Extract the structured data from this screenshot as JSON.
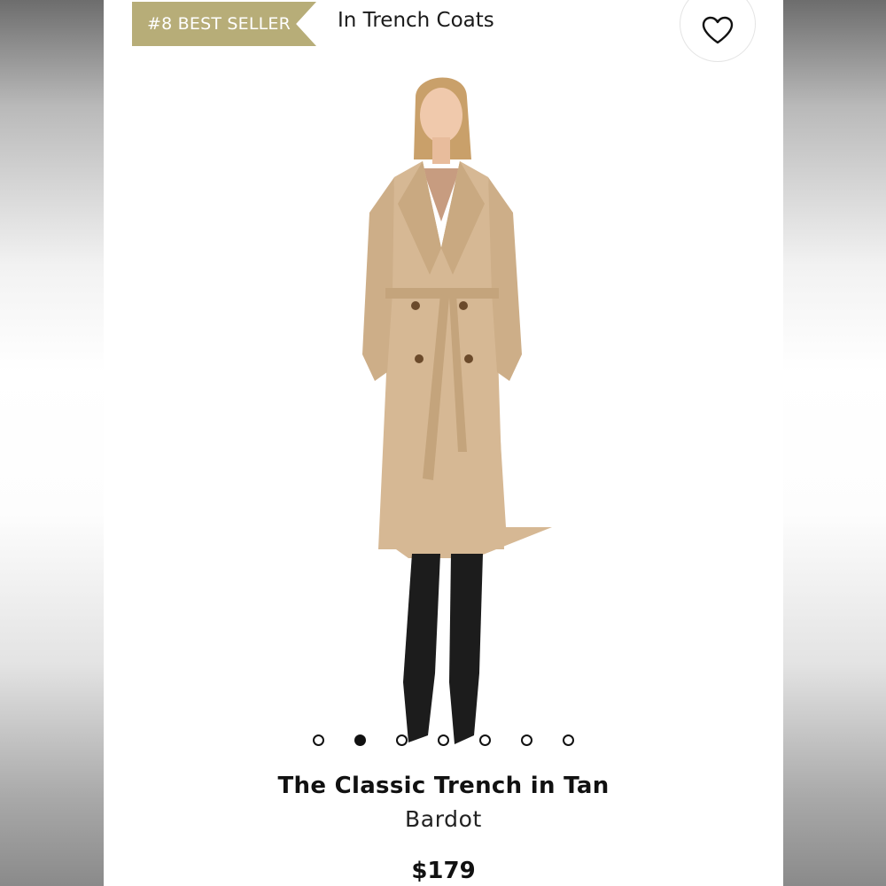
{
  "badge": {
    "text": "#8 BEST SELLER",
    "color": "#b7ad78"
  },
  "category": "In Trench Coats",
  "wishlist": {
    "icon": "heart-outline-icon"
  },
  "gallery": {
    "dot_count": 7,
    "active_index": 1
  },
  "product": {
    "name": "The Classic Trench in Tan",
    "brand": "Bardot",
    "price": "$179",
    "coat_color": "#d6b894"
  }
}
